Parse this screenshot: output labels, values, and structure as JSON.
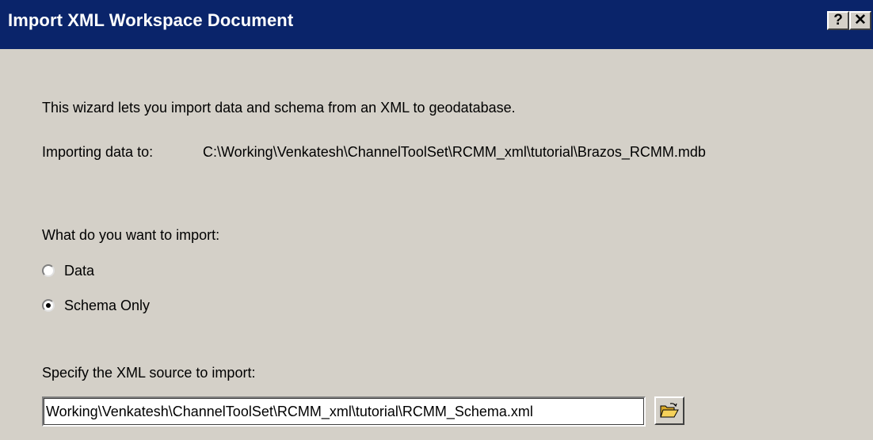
{
  "window": {
    "title": "Import XML Workspace Document",
    "help_label": "?",
    "close_label": "✕"
  },
  "intro_text": "This wizard lets you import data and schema from an XML to geodatabase.",
  "destination": {
    "label": "Importing data to:",
    "path": "C:\\Working\\Venkatesh\\ChannelToolSet\\RCMM_xml\\tutorial\\Brazos_RCMM.mdb"
  },
  "import_options": {
    "question": "What do you want to import:",
    "options": [
      {
        "label": "Data",
        "selected": false
      },
      {
        "label": "Schema Only",
        "selected": true
      }
    ]
  },
  "source": {
    "label": "Specify the XML source to import:",
    "value": "Working\\Venkatesh\\ChannelToolSet\\RCMM_xml\\tutorial\\RCMM_Schema.xml",
    "browse_icon": "open-folder-icon"
  },
  "colors": {
    "titlebar": "#0a246a",
    "dialog_face": "#d4d0c8",
    "folder": "#f5d15a"
  }
}
